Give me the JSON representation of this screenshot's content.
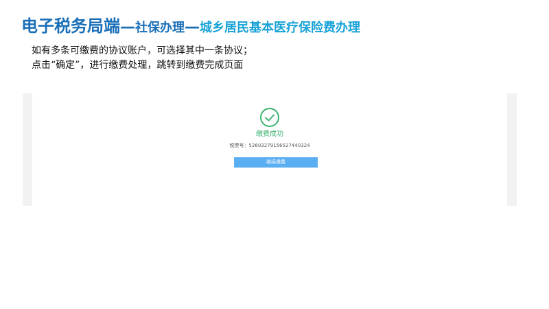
{
  "title": {
    "main": "电子税务局端",
    "separator1": "—",
    "section": "社保办理",
    "separator2": "—",
    "subsection": "城乡居民基本医疗保险费办理"
  },
  "instructions": [
    "如有多条可缴费的协议账户，可选择其中一条协议；",
    "点击“确定”，进行缴费处理，跳转到缴费完成页面"
  ],
  "result": {
    "icon": "check-circle-icon",
    "status_text": "缴费成功",
    "tax_ticket_label": "税票号：",
    "tax_ticket_number": "526032791565274403​24",
    "continue_button": "继续缴费"
  },
  "colors": {
    "title_blue": "#1a6fb8",
    "subtitle_cyan": "#17a2d8",
    "success_green": "#3bb271",
    "button_blue": "#5aaef2"
  }
}
